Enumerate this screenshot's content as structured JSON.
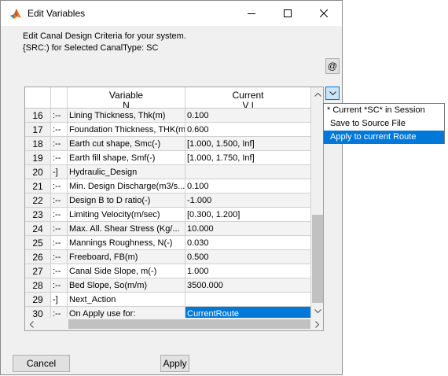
{
  "window": {
    "title": "Edit Variables"
  },
  "description": {
    "line1": "Edit Canal Design Criteria for your system.",
    "line2": "{SRC:) for Selected CanalType: SC"
  },
  "at_button": {
    "label": "@"
  },
  "table": {
    "headers": {
      "variable": "Variable",
      "variable_sub": "N",
      "current": "Current",
      "current_sub": "V l"
    },
    "rows": [
      {
        "num": "16",
        "flag": ":--",
        "variable": "Lining Thickness, Thk(m)",
        "current": "0.100"
      },
      {
        "num": "17",
        "flag": ":--",
        "variable": "Foundation Thickness, THK(m)",
        "current": "0.600"
      },
      {
        "num": "18",
        "flag": ":--",
        "variable": "Earth cut shape, Smc(-)",
        "current": "[1.000, 1.500, Inf]"
      },
      {
        "num": "19",
        "flag": ":--",
        "variable": "Earth fill shape, Smf(-)",
        "current": "[1.000, 1.750, Inf]"
      },
      {
        "num": "20",
        "flag": "-]",
        "variable": "Hydraulic_Design",
        "current": ""
      },
      {
        "num": "21",
        "flag": ":--",
        "variable": "Min. Design Discharge(m3/s...",
        "current": "0.100"
      },
      {
        "num": "22",
        "flag": ":--",
        "variable": "Design B to D ratio(-)",
        "current": "-1.000"
      },
      {
        "num": "23",
        "flag": ":--",
        "variable": "Limiting Velocity(m/sec)",
        "current": "[0.300, 1.200]"
      },
      {
        "num": "24",
        "flag": ":--",
        "variable": "Max. All. Shear Stress (Kg/...",
        "current": "10.000"
      },
      {
        "num": "25",
        "flag": ":--",
        "variable": "Mannings Roughness, N(-)",
        "current": "0.030"
      },
      {
        "num": "26",
        "flag": ":--",
        "variable": "Freeboard, FB(m)",
        "current": "0.500"
      },
      {
        "num": "27",
        "flag": ":--",
        "variable": "Canal Side Slope, m(-)",
        "current": "1.000"
      },
      {
        "num": "28",
        "flag": ":--",
        "variable": "Bed Slope, So(m/m)",
        "current": "3500.000"
      },
      {
        "num": "29",
        "flag": "-]",
        "variable": "Next_Action",
        "current": ""
      },
      {
        "num": "30",
        "flag": ":--",
        "variable": "On Apply use for:",
        "current": "CurrentRoute"
      }
    ]
  },
  "dropdown": {
    "options": [
      "* Current *SC* in Session",
      "Save to Source File",
      "Apply to current Route"
    ],
    "selected_index": 2
  },
  "buttons": {
    "cancel": "Cancel",
    "apply": "Apply"
  },
  "colors": {
    "selection": "#0078d7",
    "window_bg": "#f0f0f0"
  }
}
